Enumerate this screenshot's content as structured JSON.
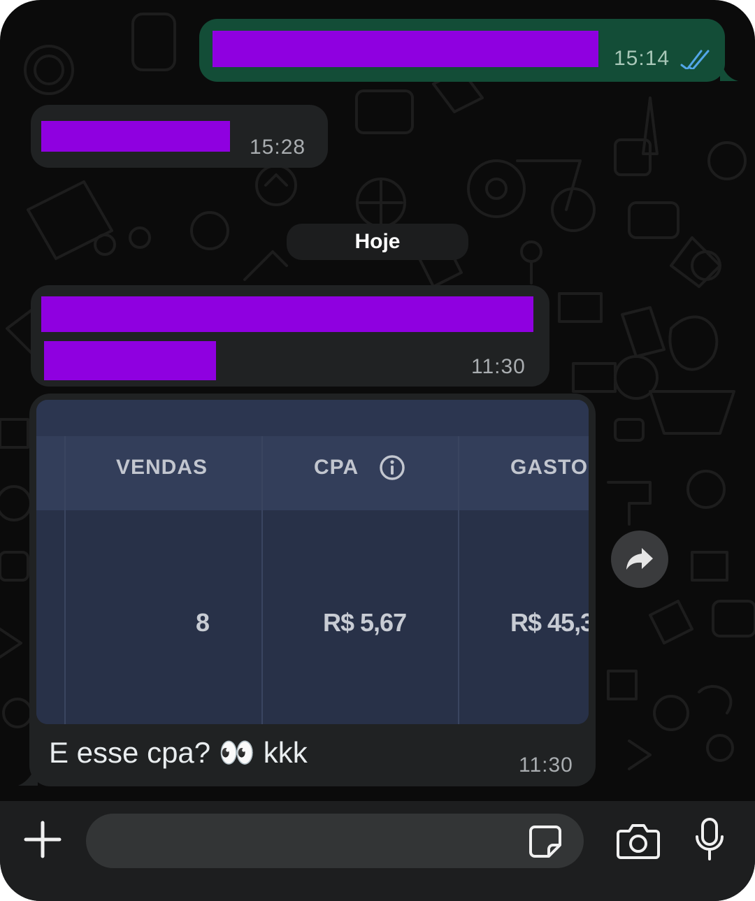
{
  "messages": [
    {
      "direction": "outgoing",
      "time": "15:14",
      "read_receipt": "double-check-blue"
    },
    {
      "direction": "incoming",
      "time": "15:28"
    },
    {
      "direction": "incoming",
      "time": "11:30"
    },
    {
      "direction": "incoming",
      "time": "11:30",
      "caption": "E esse cpa? 👀 kkk"
    }
  ],
  "date_separator": "Hoje",
  "image": {
    "headers": [
      "VENDAS",
      "CPA",
      "GASTO"
    ],
    "values": [
      "8",
      "R$ 5,67",
      "R$ 45,3"
    ],
    "info_icon": "info-circle-icon"
  },
  "colors": {
    "outgoing_bubble": "#134d37",
    "incoming_bubble": "#202223",
    "redaction": "#8f00e0",
    "read_tick": "#53a6e8"
  },
  "composer": {
    "attach_icon": "plus-icon",
    "sticker_icon": "sticker-icon",
    "camera_icon": "camera-icon",
    "mic_icon": "microphone-icon",
    "text": ""
  },
  "forward_icon": "forward-icon"
}
